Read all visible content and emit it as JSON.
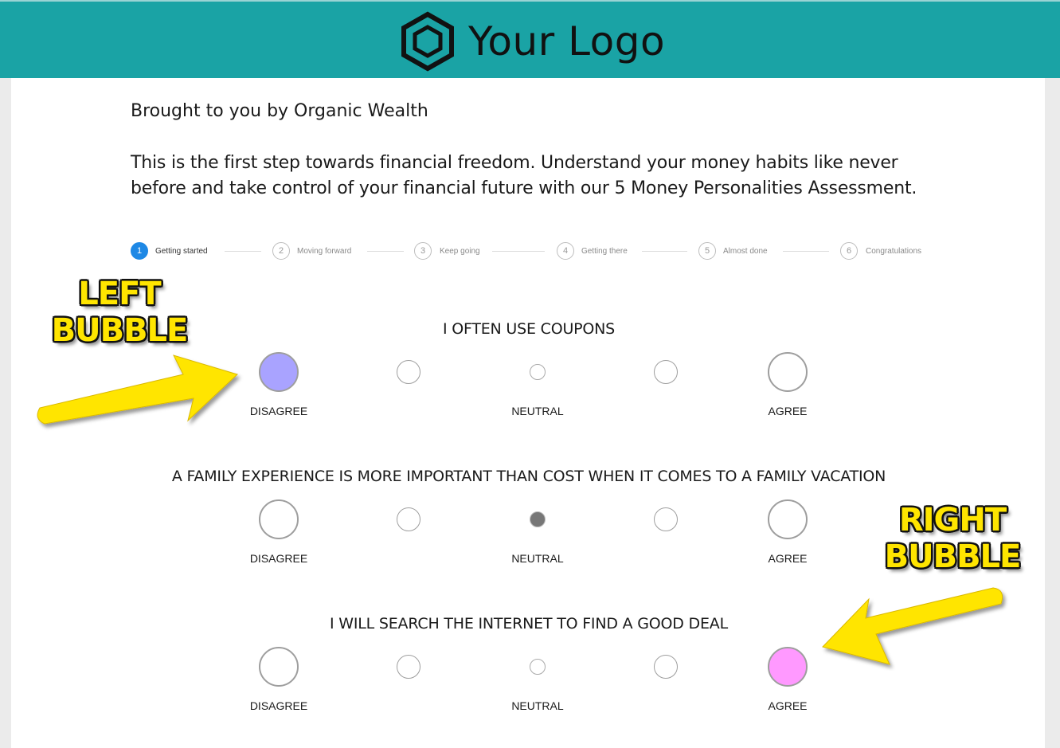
{
  "header": {
    "logo_text": "Your Logo",
    "brand_color": "#1aa3a5",
    "logo_icon": "hexagon-logo-icon"
  },
  "byline": "Brought to you by Organic Wealth",
  "intro": "This is the first step towards financial freedom. Understand your money habits like never before and take control of your financial future with our 5 Money Personalities Assessment.",
  "stepper": {
    "active_color": "#1e88e5",
    "steps": [
      {
        "number": "1",
        "label": "Getting started",
        "active": true
      },
      {
        "number": "2",
        "label": "Moving forward",
        "active": false
      },
      {
        "number": "3",
        "label": "Keep going",
        "active": false
      },
      {
        "number": "4",
        "label": "Getting there",
        "active": false
      },
      {
        "number": "5",
        "label": "Almost done",
        "active": false
      },
      {
        "number": "6",
        "label": "Congratulations",
        "active": false
      }
    ]
  },
  "scale_labels": {
    "left": "DISAGREE",
    "middle": "NEUTRAL",
    "right": "AGREE"
  },
  "questions": [
    {
      "text": "I OFTEN USE COUPONS",
      "selected_index": 0,
      "selected_color": "#a9a3ff"
    },
    {
      "text": "A FAMILY EXPERIENCE IS MORE IMPORTANT THAN COST WHEN IT COMES TO A FAMILY VACATION",
      "selected_index": 2,
      "selected_color": "#777777"
    },
    {
      "text": "I WILL SEARCH THE INTERNET TO FIND A GOOD DEAL",
      "selected_index": 4,
      "selected_color": "#ff99ff"
    }
  ],
  "annotations": {
    "left": {
      "line1": "LEFT",
      "line2": "BUBBLE"
    },
    "right": {
      "line1": "RIGHT",
      "line2": "BUBBLE"
    },
    "arrow_color": "#ffe500"
  }
}
